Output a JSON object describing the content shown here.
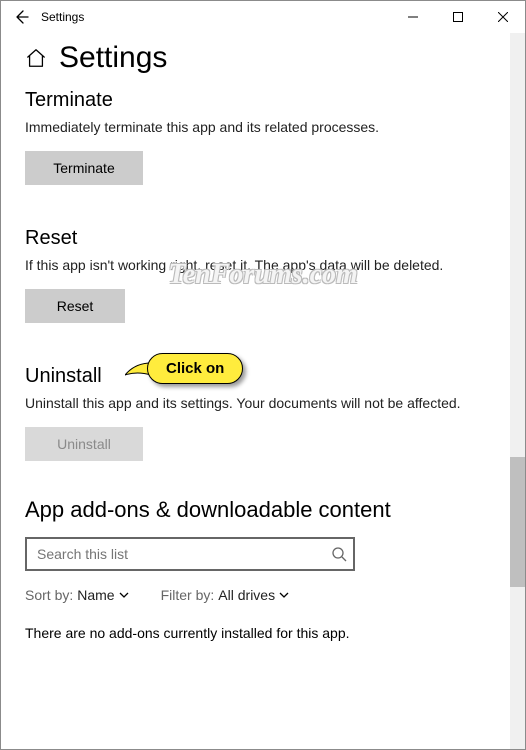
{
  "window": {
    "app_name": "Settings"
  },
  "page": {
    "title": "Settings"
  },
  "terminate": {
    "heading": "Terminate",
    "description": "Immediately terminate this app and its related processes.",
    "button": "Terminate"
  },
  "reset": {
    "heading": "Reset",
    "description": "If this app isn't working right, reset it. The app's data will be deleted.",
    "button": "Reset"
  },
  "uninstall": {
    "heading": "Uninstall",
    "description": "Uninstall this app and its settings. Your documents will not be affected.",
    "button": "Uninstall"
  },
  "addons": {
    "heading": "App add-ons & downloadable content",
    "search_placeholder": "Search this list",
    "sort_label": "Sort by:",
    "sort_value": "Name",
    "filter_label": "Filter by:",
    "filter_value": "All drives",
    "empty": "There are no add-ons currently installed for this app."
  },
  "watermark": "TenForums.com",
  "callout": "Click on"
}
